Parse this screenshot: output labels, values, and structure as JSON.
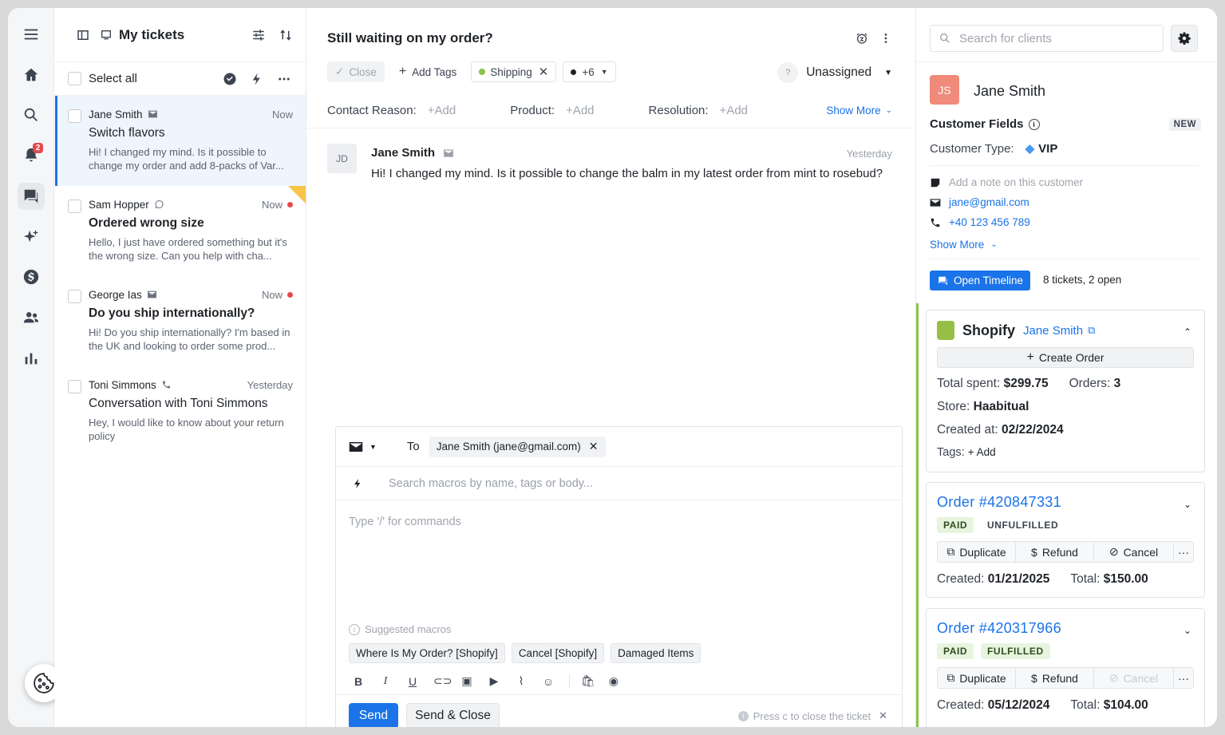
{
  "nav": {
    "items": [
      "menu-icon",
      "home-icon",
      "search-icon",
      "bell-icon",
      "chat-icon",
      "sparkle-icon",
      "dollar-icon",
      "people-icon",
      "chart-icon"
    ],
    "notification_count": "2"
  },
  "list": {
    "title": "My tickets",
    "select_all": "Select all",
    "tickets": [
      {
        "name": "Jane Smith",
        "channel": "mail",
        "time": "Now",
        "subject": "Switch flavors",
        "preview": "Hi! I changed my mind. Is it possible to change my order and add 8-packs of Var..."
      },
      {
        "name": "Sam Hopper",
        "channel": "whatsapp",
        "time": "Now",
        "subject": "Ordered wrong size",
        "preview": "Hello, I just have ordered something but it's the wrong size. Can you help with cha..."
      },
      {
        "name": "George Ias",
        "channel": "mail",
        "time": "Now",
        "subject": "Do you ship internationally?",
        "preview": "Hi! Do you ship internationally? I'm based in the UK and looking to order some prod..."
      },
      {
        "name": "Toni Simmons",
        "channel": "phone",
        "time": "Yesterday",
        "subject": "Conversation with Toni Simmons",
        "preview": "Hey, I would like to know about your return policy"
      }
    ]
  },
  "ticket": {
    "title": "Still waiting on my order?",
    "close": "Close",
    "add_tags": "Add Tags",
    "tag": "Shipping",
    "more_tags": "+6",
    "assignee_avatar": "?",
    "assignee": "Unassigned",
    "contact_reason": "Contact Reason:",
    "product": "Product:",
    "resolution": "Resolution:",
    "add": "+Add",
    "show_more": "Show More",
    "message": {
      "initials": "JD",
      "author": "Jane Smith",
      "time": "Yesterday",
      "body": "Hi! I changed my mind. Is it possible to change the balm in my latest order from mint to rosebud?"
    }
  },
  "composer": {
    "to_label": "To",
    "recipient": "Jane Smith (jane@gmail.com)",
    "macro_placeholder": "Search macros by name, tags or body...",
    "body_placeholder": "Type '/' for commands",
    "suggested": "Suggested macros",
    "macros": [
      "Where Is My Order? [Shopify]",
      "Cancel [Shopify]",
      "Damaged Items"
    ],
    "send": "Send",
    "send_close": "Send & Close",
    "hint": "Press c to close the ticket"
  },
  "customer": {
    "search_placeholder": "Search for clients",
    "initials": "JS",
    "name": "Jane Smith",
    "fields_label": "Customer Fields",
    "new_badge": "NEW",
    "type_label": "Customer Type:",
    "type_value": "VIP",
    "note_placeholder": "Add a note on this customer",
    "email": "jane@gmail.com",
    "phone": "+40 123 456 789",
    "show_more": "Show More",
    "open_timeline": "Open Timeline",
    "tickets_summary": "8 tickets, 2 open"
  },
  "shopify": {
    "title": "Shopify",
    "customer_link": "Jane Smith",
    "create_order": "Create Order",
    "total_spent_label": "Total spent:",
    "total_spent": "$299.75",
    "orders_label": "Orders:",
    "orders": "3",
    "store_label": "Store:",
    "store": "Haabitual",
    "created_label": "Created at:",
    "created": "02/22/2024",
    "tags_label": "Tags:",
    "tags_add": "+ Add",
    "orders_list": [
      {
        "number": "Order #420847331",
        "paid": "PAID",
        "fulfillment": "UNFULFILLED",
        "created_label": "Created:",
        "created": "01/21/2025",
        "total_label": "Total:",
        "total": "$150.00"
      },
      {
        "number": "Order #420317966",
        "paid": "PAID",
        "fulfillment": "FULFILLED",
        "created_label": "Created:",
        "created": "05/12/2024",
        "total_label": "Total:",
        "total": "$104.00"
      }
    ],
    "actions": {
      "duplicate": "Duplicate",
      "refund": "Refund",
      "cancel": "Cancel"
    }
  }
}
